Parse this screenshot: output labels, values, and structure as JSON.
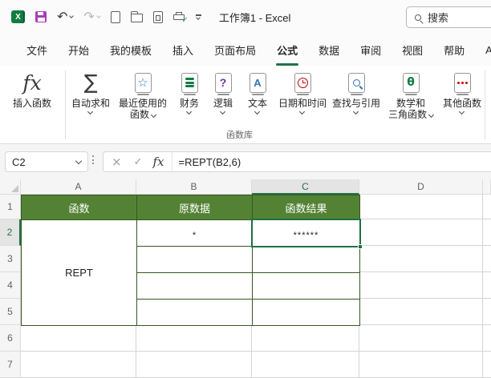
{
  "colors": {
    "accent_green": "#217346",
    "header_fill_green": "#548235",
    "table_border_green": "#375623",
    "save_icon_purple": "#a83dba",
    "excel_logo_green": "#107c41"
  },
  "title_bar": {
    "title": "工作簿1 - Excel",
    "search_placeholder": "搜索",
    "qat_icons": [
      "excel-logo",
      "save",
      "undo",
      "redo",
      "new-file",
      "open-folder",
      "print-preview",
      "quick-print",
      "customize-toolbar"
    ]
  },
  "tabs": [
    {
      "label": "文件"
    },
    {
      "label": "开始"
    },
    {
      "label": "我的模板"
    },
    {
      "label": "插入"
    },
    {
      "label": "页面布局"
    },
    {
      "label": "公式"
    },
    {
      "label": "数据"
    },
    {
      "label": "审阅"
    },
    {
      "label": "视图"
    },
    {
      "label": "帮助"
    },
    {
      "label": "AIPPT"
    }
  ],
  "active_tab": "公式",
  "ribbon": {
    "group_label": "函数库",
    "buttons": [
      {
        "label": "插入函数",
        "icon": "insert-function",
        "dropdown": false
      },
      {
        "label": "自动求和",
        "icon": "autosum",
        "dropdown": true
      },
      {
        "label": "最近使用的函数",
        "line1": "最近使用的",
        "line2": "函数",
        "icon": "recently-used-functions",
        "dropdown": true
      },
      {
        "label": "财务",
        "icon": "financial-functions",
        "dropdown": true
      },
      {
        "label": "逻辑",
        "icon": "logical-functions",
        "dropdown": true
      },
      {
        "label": "文本",
        "icon": "text-functions",
        "dropdown": true
      },
      {
        "label": "日期和时间",
        "icon": "date-time-functions",
        "dropdown": true
      },
      {
        "label": "查找与引用",
        "icon": "lookup-reference-functions",
        "dropdown": true
      },
      {
        "label": "数学和三角函数",
        "line1": "数学和",
        "line2": "三角函数",
        "icon": "math-trig-functions",
        "dropdown": true
      },
      {
        "label": "其他函数",
        "icon": "more-functions",
        "dropdown": true
      }
    ]
  },
  "formula_bar": {
    "name_box": "C2",
    "formula": "=REPT(B2,6)",
    "icons": [
      "cancel",
      "enter",
      "insert-function"
    ]
  },
  "grid": {
    "column_headers": [
      "A",
      "B",
      "C",
      "D"
    ],
    "row_headers": [
      "1",
      "2",
      "3",
      "4",
      "5",
      "6",
      "7"
    ],
    "selected_cell": "C2",
    "selected_column": "C",
    "selected_row": "2",
    "cells": {
      "A1": "函数",
      "B1": "原数据",
      "C1": "函数结果",
      "A2_A5": "REPT",
      "B2": "*",
      "C2": "******"
    }
  }
}
